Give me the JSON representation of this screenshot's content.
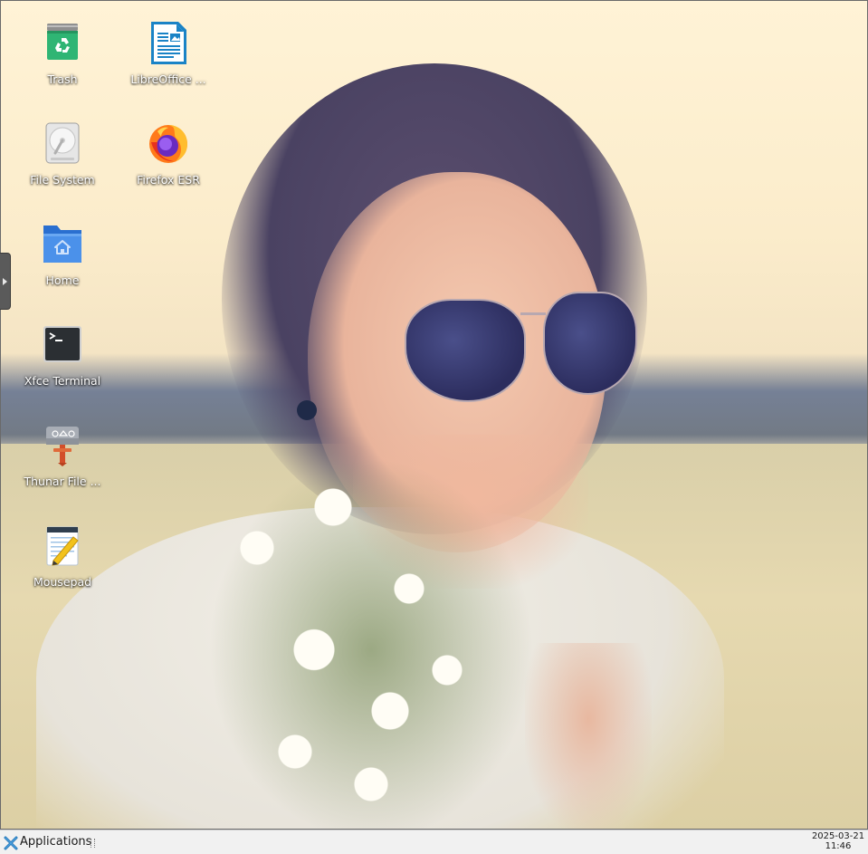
{
  "desktop": {
    "icons": [
      {
        "label": "Trash",
        "icon": "trash-icon"
      },
      {
        "label": "LibreOffice ...",
        "icon": "libreoffice-writer-icon"
      },
      {
        "label": "File System",
        "icon": "drive-harddisk-icon"
      },
      {
        "label": "Firefox ESR",
        "icon": "firefox-icon"
      },
      {
        "label": "Home",
        "icon": "home-folder-icon"
      },
      {
        "label": "Xfce Terminal",
        "icon": "terminal-icon"
      },
      {
        "label": "Thunar File ...",
        "icon": "thunar-file-manager-icon"
      },
      {
        "label": "Mousepad",
        "icon": "mousepad-text-editor-icon"
      }
    ]
  },
  "taskbar": {
    "applications_label": "Applications",
    "clock_date": "2025-03-21",
    "clock_time": "11:46"
  },
  "colors": {
    "label_text": "#ffffff",
    "taskbar_bg": "#f1f1f1",
    "xfce_accent": "#2a7ab8"
  }
}
